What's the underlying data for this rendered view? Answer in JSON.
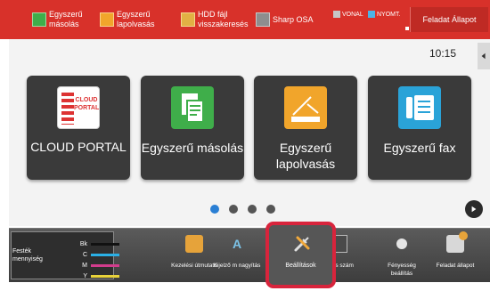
{
  "topbar": {
    "shortcuts": [
      {
        "label": "Egyszerű másolás",
        "icon": "copy-icon"
      },
      {
        "label": "Egyszerű lapolvasás",
        "icon": "scan-icon"
      },
      {
        "label": "HDD fájl visszakeresés",
        "icon": "folder-icon"
      },
      {
        "label": "Sharp OSA",
        "icon": "osa-icon"
      }
    ],
    "lamps": [
      {
        "label": "VONAL",
        "color": "#c7c7c7"
      },
      {
        "label": "NYOMT.",
        "color": "#4db3e6"
      }
    ],
    "job_status": "Feladat Állapot",
    "color": "#d8312a"
  },
  "main": {
    "time": "10:15",
    "tiles": [
      {
        "label": "CLOUD PORTAL",
        "icon": "cloud-portal-icon",
        "icon_text": "CLOUD PORTAL"
      },
      {
        "label": "Egyszerű másolás",
        "icon": "copy-icon"
      },
      {
        "label": "Egyszerű lapolvasás",
        "icon": "scan-icon"
      },
      {
        "label": "Egyszerű fax",
        "icon": "fax-icon"
      }
    ],
    "page_count": 4,
    "active_page": 1
  },
  "bottombar": {
    "toner": {
      "title": "Festék mennyiség",
      "rows": [
        {
          "label": "Bk",
          "color": "#111111"
        },
        {
          "label": "C",
          "color": "#2ab0e6"
        },
        {
          "label": "M",
          "color": "#d23c8c"
        },
        {
          "label": "Y",
          "color": "#e8d23a"
        }
      ]
    },
    "items": [
      {
        "label": "Kezelési útmutató",
        "icon": "manual-icon"
      },
      {
        "label": "Kijelző m nagyítás",
        "icon": "zoom-icon",
        "icon_text": "A"
      },
      {
        "label": "Beállítások",
        "icon": "settings-icon"
      },
      {
        "label": "sszes szám",
        "icon": "counter-icon"
      },
      {
        "label": "Fényesség beállítás",
        "icon": "brightness-icon"
      },
      {
        "label": "Feladat állapot",
        "icon": "job-status-icon"
      }
    ],
    "highlight_color": "#d8243c"
  }
}
